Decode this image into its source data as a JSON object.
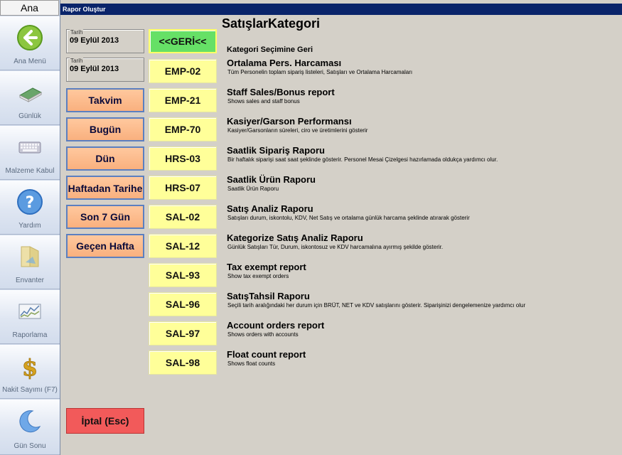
{
  "nav": {
    "title": "Ana",
    "items": [
      {
        "label": "Ana Menü",
        "icon": "back-arrow-icon"
      },
      {
        "label": "Günlük",
        "icon": "book-icon"
      },
      {
        "label": "Malzeme Kabul",
        "icon": "keyboard-icon"
      },
      {
        "label": "Yardım",
        "icon": "help-icon"
      },
      {
        "label": "Envanter",
        "icon": "folder-icon"
      },
      {
        "label": "Raporlama",
        "icon": "chart-icon"
      },
      {
        "label": "Nakit Sayımı (F7)",
        "icon": "dollar-icon"
      },
      {
        "label": "Gün Sonu",
        "icon": "moon-icon"
      }
    ]
  },
  "window": {
    "title": "Rapor Oluştur",
    "heading": "SatışlarKategori"
  },
  "dates": [
    {
      "label": "Tarih",
      "value": "09 Eylül 2013"
    },
    {
      "label": "Tarih",
      "value": "09 Eylül 2013"
    }
  ],
  "quick_ranges": [
    "Takvim",
    "Bugün",
    "Dün",
    "Haftadan Tarihe",
    "Son 7 Gün",
    "Geçen Hafta"
  ],
  "cancel_label": "İptal (Esc)",
  "back": {
    "label": "<<GERİ<<",
    "title": "Kategori Seçimine Geri"
  },
  "reports": [
    {
      "code": "EMP-02",
      "title": "Ortalama Pers. Harcaması",
      "desc": "Tüm Personelin toplam sipariş listeleri, Satışları ve Ortalama Harcamaları"
    },
    {
      "code": "EMP-21",
      "title": "Staff Sales/Bonus report",
      "desc": "Shows sales and staff bonus"
    },
    {
      "code": "EMP-70",
      "title": "Kasiyer/Garson Performansı",
      "desc": "Kasiyer/Garsonların süreleri, ciro ve üretimlerini gösterir"
    },
    {
      "code": "HRS-03",
      "title": "Saatlik Sipariş Raporu",
      "desc": "Bir haftalık siparişi saat saat şeklinde gösterir. Personel Mesai Çizelgesi hazırlamada oldukça yardımcı olur."
    },
    {
      "code": "HRS-07",
      "title": "Saatlik Ürün Raporu",
      "desc": "Saatlik Ürün Raporu"
    },
    {
      "code": "SAL-02",
      "title": "Satış Analiz Raporu",
      "desc": "Satışları durum, iskontolu, KDV, Net Satış ve ortalama günlük harcama şeklinde atırarak gösterir"
    },
    {
      "code": "SAL-12",
      "title": "Kategorize Satış Analiz Raporu",
      "desc": "Günlük Satışları Tür, Durum, iskontosuz ve KDV harcamalına ayırmış şekilde gösterir."
    },
    {
      "code": "SAL-93",
      "title": "Tax exempt report",
      "desc": "Show tax exempt orders"
    },
    {
      "code": "SAL-96",
      "title": "SatışTahsil Raporu",
      "desc": "Seçili tarih aralığındaki her durum için BRÜT, NET ve KDV satışlarını gösterir. Siparişinizi dengelemenize yardımcı olur"
    },
    {
      "code": "SAL-97",
      "title": "Account orders report",
      "desc": "Shows orders with accounts"
    },
    {
      "code": "SAL-98",
      "title": "Float count report",
      "desc": "Shows float counts"
    }
  ]
}
